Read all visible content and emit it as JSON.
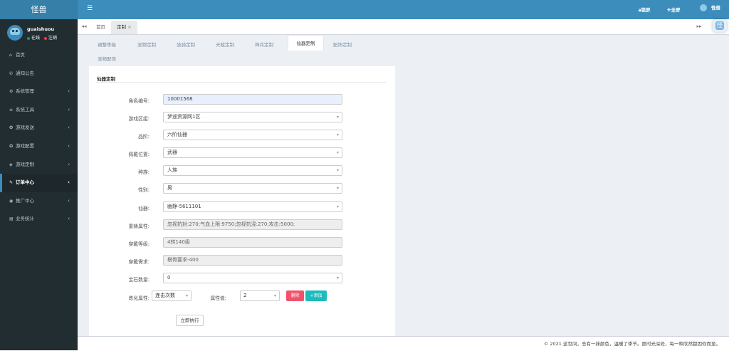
{
  "app": {
    "logo": "怪兽"
  },
  "user": {
    "name": "guaishuou",
    "online": "在线",
    "logout": "注销",
    "online_color": "#00a65a",
    "logout_color": "#dd4b39"
  },
  "sidebar": {
    "items": [
      {
        "label": "首页",
        "icon": "home-icon",
        "glyph": "⌂",
        "has_caret": false
      },
      {
        "label": "通知公告",
        "icon": "bullhorn-icon",
        "glyph": "✆",
        "has_caret": false
      },
      {
        "label": "系统管理",
        "icon": "gear-icon",
        "glyph": "⚙",
        "has_caret": true
      },
      {
        "label": "系统工具",
        "icon": "list-icon",
        "glyph": "≡",
        "has_caret": true
      },
      {
        "label": "游戏发送",
        "icon": "gamepad-icon",
        "glyph": "✪",
        "has_caret": true
      },
      {
        "label": "游戏配置",
        "icon": "gamepad-icon",
        "glyph": "✪",
        "has_caret": true
      },
      {
        "label": "游戏定制",
        "icon": "compass-icon",
        "glyph": "◈",
        "has_caret": true
      },
      {
        "label": "订单中心",
        "icon": "wrench-icon",
        "glyph": "✎",
        "has_caret": true,
        "active": true
      },
      {
        "label": "推广中心",
        "icon": "eye-icon",
        "glyph": "◉",
        "has_caret": true
      },
      {
        "label": "业务统计",
        "icon": "chart-icon",
        "glyph": "▤",
        "has_caret": true
      }
    ]
  },
  "topbar": {
    "lock": "锁屏",
    "fullscreen": "全屏",
    "username": "怪兽"
  },
  "tabs": {
    "home": "首页",
    "current": "定制"
  },
  "subtabs": [
    {
      "label": "调整等级"
    },
    {
      "label": "宠物定制"
    },
    {
      "label": "坐骑定制"
    },
    {
      "label": "天赋定制"
    },
    {
      "label": "神兵定制"
    },
    {
      "label": "仙器定制",
      "active": true
    },
    {
      "label": "配饰定制"
    },
    {
      "label": "宠物配饰"
    }
  ],
  "form": {
    "title": "仙器定制",
    "fields": [
      {
        "label": "角色编号:",
        "value": "10001568",
        "kind": "input-highlight"
      },
      {
        "label": "游戏区组:",
        "value": "梦遥资源网1区",
        "kind": "select"
      },
      {
        "label": "品阶:",
        "value": "六阶仙器",
        "kind": "select"
      },
      {
        "label": "佩戴位置:",
        "value": "武器",
        "kind": "select"
      },
      {
        "label": "种族:",
        "value": "人族",
        "kind": "select"
      },
      {
        "label": "性别:",
        "value": "男",
        "kind": "select"
      },
      {
        "label": "仙器:",
        "value": "幽静-5611101",
        "kind": "select"
      },
      {
        "label": "重铸属性:",
        "value": "忽视抗封:270;气血上限:9750;忽视抗混:270;攻击:5000;",
        "kind": "disabled"
      },
      {
        "label": "穿戴等级:",
        "value": "4转140级",
        "kind": "disabled"
      },
      {
        "label": "穿戴需求:",
        "value": "根骨要求-400",
        "kind": "disabled"
      },
      {
        "label": "宝石数量:",
        "value": "0",
        "kind": "select"
      }
    ],
    "refine": {
      "label": "炼化属性:",
      "type_value": "连击次数",
      "attr_label": "属性值:",
      "attr_value": "2",
      "delete": "删除",
      "add": "+添加"
    },
    "execute": "立即执行"
  },
  "colors": {
    "delete": "#f0536b",
    "add": "#1cbcbc",
    "topbar": "#3c8dbc",
    "sidebar": "#222d32"
  },
  "footer": "© 2021 这世间，总有一抹颜色，温暖了季节。愿时光深处，每一种欣然都因你而至。"
}
